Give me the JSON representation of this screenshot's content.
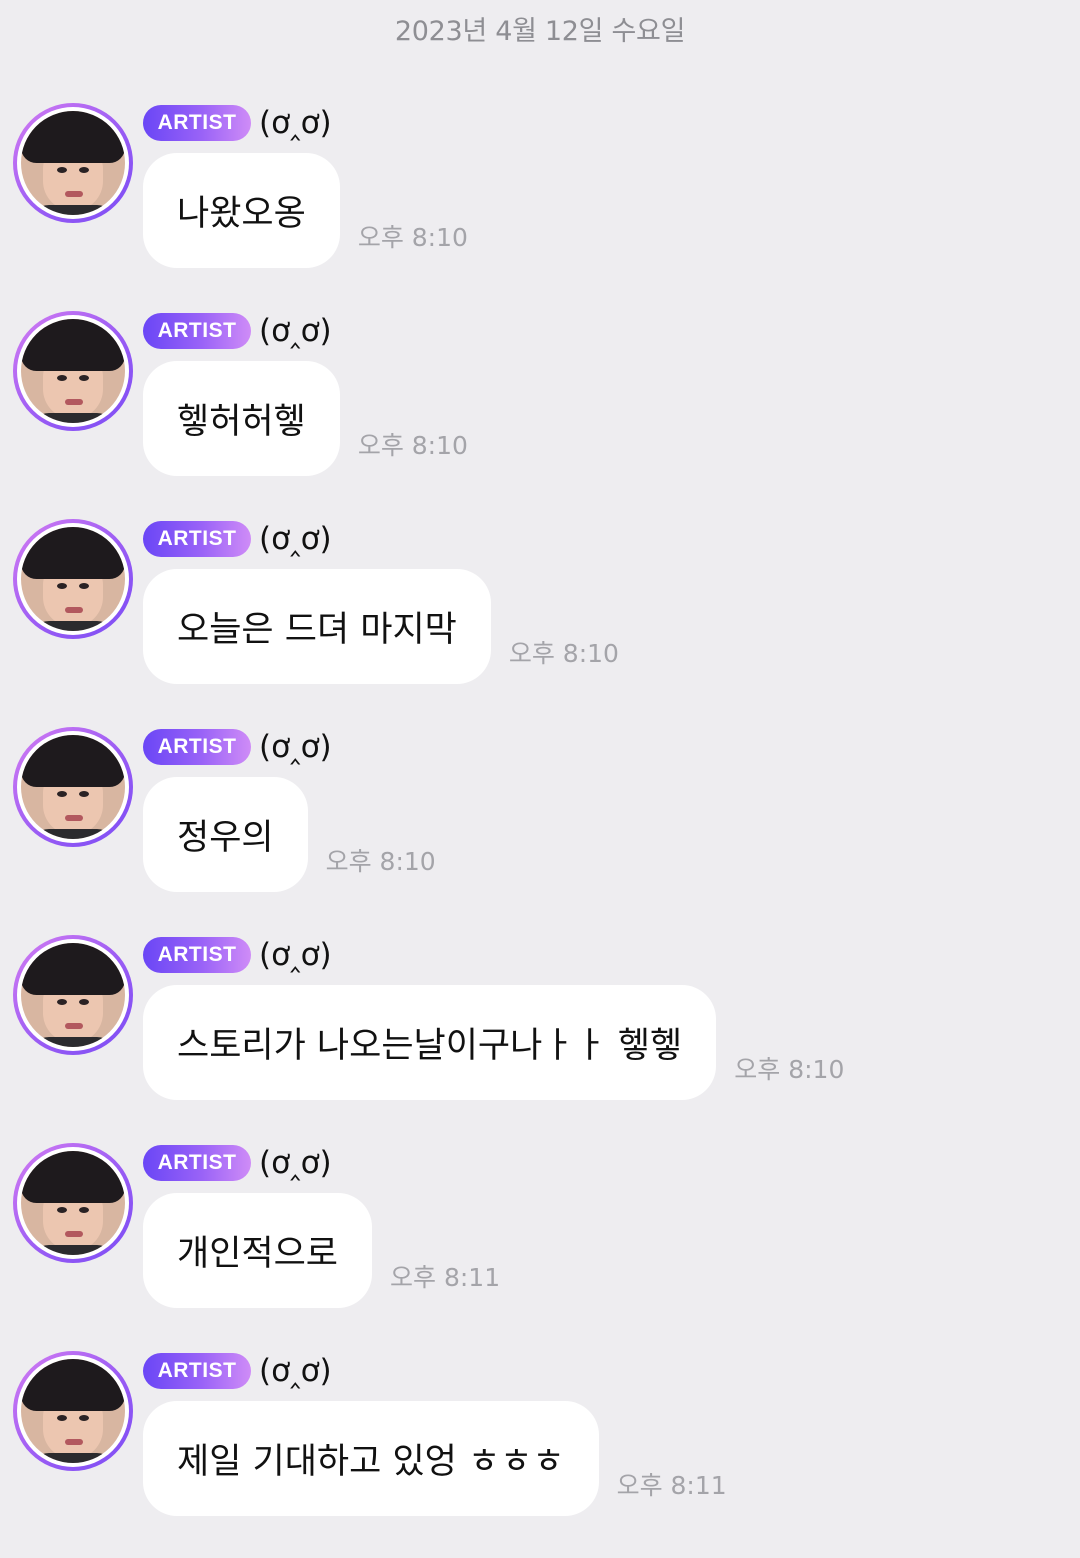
{
  "date_header": "2023년 4월 12일 수요일",
  "messages": [
    {
      "badge": "ARTIST",
      "nickname": "(ơ‸ơ)",
      "text": "나왔오옹",
      "time": "오후 8:10"
    },
    {
      "badge": "ARTIST",
      "nickname": "(ơ‸ơ)",
      "text": "헿허허헿",
      "time": "오후 8:10"
    },
    {
      "badge": "ARTIST",
      "nickname": "(ơ‸ơ)",
      "text": "오늘은 드뎌 마지막",
      "time": "오후 8:10"
    },
    {
      "badge": "ARTIST",
      "nickname": "(ơ‸ơ)",
      "text": "정우의",
      "time": "오후 8:10"
    },
    {
      "badge": "ARTIST",
      "nickname": "(ơ‸ơ)",
      "text": "스토리가 나오는날이구나ㅏㅏ 헿헿",
      "time": "오후 8:10"
    },
    {
      "badge": "ARTIST",
      "nickname": "(ơ‸ơ)",
      "text": "개인적으로",
      "time": "오후 8:11"
    },
    {
      "badge": "ARTIST",
      "nickname": "(ơ‸ơ)",
      "text": "제일 기대하고 있엉 ㅎㅎㅎ",
      "time": "오후 8:11"
    }
  ],
  "colors": {
    "background": "#eeedf0",
    "badge_gradient_start": "#6a46f6",
    "badge_gradient_end": "#cf8cf7",
    "avatar_ring": "#9a5cf4",
    "bubble": "#ffffff",
    "timestamp": "#a4a4a9"
  },
  "icons": {
    "avatar": "artist-profile-photo"
  }
}
